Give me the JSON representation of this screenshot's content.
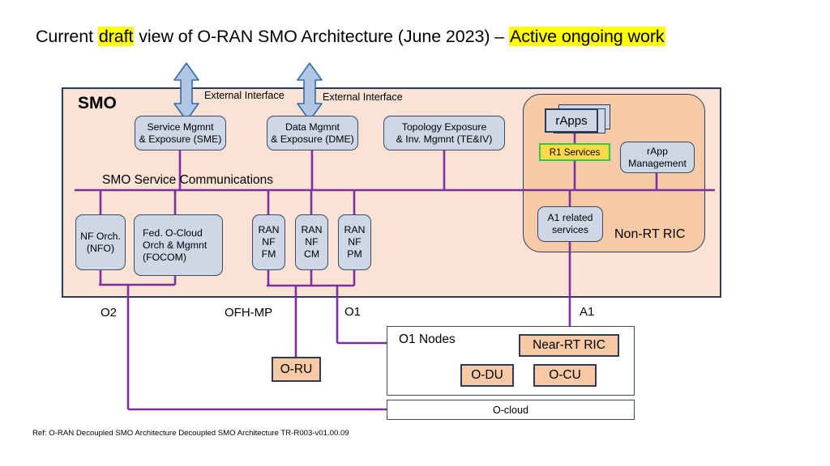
{
  "title": {
    "part1": "Current ",
    "draft": "draft",
    "part2": " view of O-RAN SMO Architecture (June 2023) – ",
    "active": "Active ongoing work"
  },
  "smo": {
    "label": "SMO",
    "service_bus_label": "SMO Service Communications",
    "external_interface_1": "External Interface",
    "external_interface_2": "External Interface",
    "top_nodes": [
      {
        "line1": "Service Mgmnt",
        "line2": "& Exposure (SME)"
      },
      {
        "line1": "Data Mgmnt",
        "line2": "& Exposure (DME)"
      },
      {
        "line1": "Topology Exposure",
        "line2": "& Inv. Mgmnt (TE&IV)"
      }
    ],
    "bottom_nodes": [
      {
        "line1": "NF Orch.",
        "line2": "(NFO)"
      },
      {
        "line1": "Fed. O-Cloud",
        "line2": "Orch & Mgmnt",
        "line3": "(FOCOM)"
      },
      {
        "line1": "RAN",
        "line2": "NF",
        "line3": "FM"
      },
      {
        "line1": "RAN",
        "line2": "NF",
        "line3": "CM"
      },
      {
        "line1": "RAN",
        "line2": "NF",
        "line3": "PM"
      }
    ]
  },
  "nonrt_ric": {
    "label": "Non-RT RIC",
    "rapps": "rApps",
    "r1_services": "R1 Services",
    "rapp_management": {
      "line1": "rApp",
      "line2": "Management"
    },
    "a1_related": {
      "line1": "A1 related",
      "line2": "services"
    }
  },
  "interfaces": {
    "o2": "O2",
    "ofh_mp": "OFH-MP",
    "o1": "O1",
    "a1": "A1"
  },
  "bottom": {
    "o_ru": "O-RU",
    "o1_nodes_title": "O1 Nodes",
    "near_rt_ric": "Near-RT RIC",
    "o_du": "O-DU",
    "o_cu": "O-CU",
    "o_cloud": "O-cloud"
  },
  "footer": "Ref: O-RAN Decoupled SMO Architecture Decoupled SMO Architecture TR-R003-v01.00.09",
  "colors": {
    "highlight": "#FFFF00",
    "smo_fill": "#FAE3D4",
    "nonrt_fill": "#F7CBA8",
    "node_fill": "#CDD7E6",
    "node_border": "#3A4A63",
    "peach_fill": "#F7C9A4",
    "wire": "#7B2FA0",
    "r1_fill": "#FFD94A",
    "r1_border": "#2ECC40",
    "arrow_fill": "#AFC6E4"
  }
}
